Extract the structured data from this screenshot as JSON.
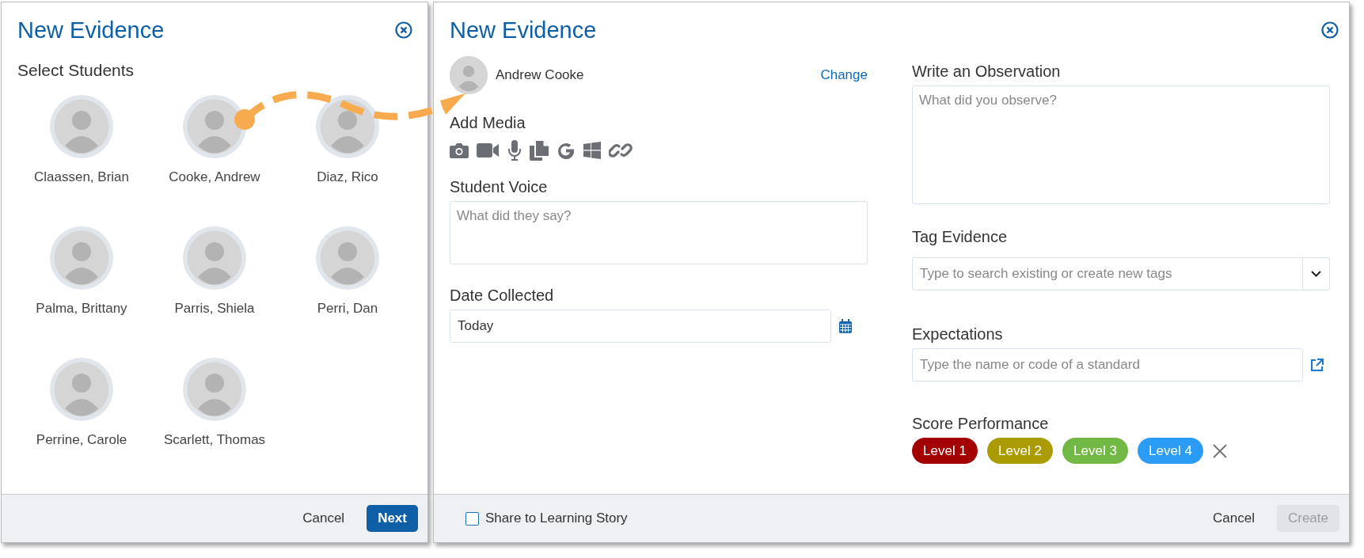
{
  "select_dialog": {
    "title": "New Evidence",
    "section_label": "Select Students",
    "students": [
      {
        "name": "Claassen, Brian"
      },
      {
        "name": "Cooke, Andrew"
      },
      {
        "name": "Diaz, Rico"
      },
      {
        "name": "Palma, Brittany"
      },
      {
        "name": "Parris, Shiela"
      },
      {
        "name": "Perri, Dan"
      },
      {
        "name": "Perrine, Carole"
      },
      {
        "name": "Scarlett, Thomas"
      }
    ],
    "buttons": [
      {
        "label": "Cancel",
        "kind": "secondary"
      },
      {
        "label": "Next",
        "kind": "primary"
      }
    ]
  },
  "evidence_dialog": {
    "title": "New Evidence",
    "student": {
      "name": "Andrew Cooke",
      "change_link": "Change"
    },
    "add_media": {
      "label": "Add Media"
    },
    "student_voice": {
      "label": "Student Voice",
      "placeholder": "What did they say?"
    },
    "date_collected": {
      "label": "Date Collected",
      "value": "Today"
    },
    "observation": {
      "label": "Write an Observation",
      "placeholder": "What did you observe?"
    },
    "tag_evidence": {
      "label": "Tag Evidence",
      "placeholder": "Type to search existing or create new tags"
    },
    "expectations": {
      "label": "Expectations",
      "placeholder": "Type the name or code of a standard"
    },
    "score_performance": {
      "label": "Score Performance",
      "levels": [
        {
          "label": "Level 1",
          "color": "#a30000"
        },
        {
          "label": "Level 2",
          "color": "#aa9b00"
        },
        {
          "label": "Level 3",
          "color": "#72b844"
        },
        {
          "label": "Level 4",
          "color": "#2b9cf5"
        }
      ]
    },
    "share": {
      "label": "Share to Learning Story",
      "checked": false
    },
    "buttons": [
      {
        "label": "Cancel",
        "kind": "secondary",
        "disabled": false
      },
      {
        "label": "Create",
        "kind": "primary",
        "disabled": true
      }
    ]
  }
}
